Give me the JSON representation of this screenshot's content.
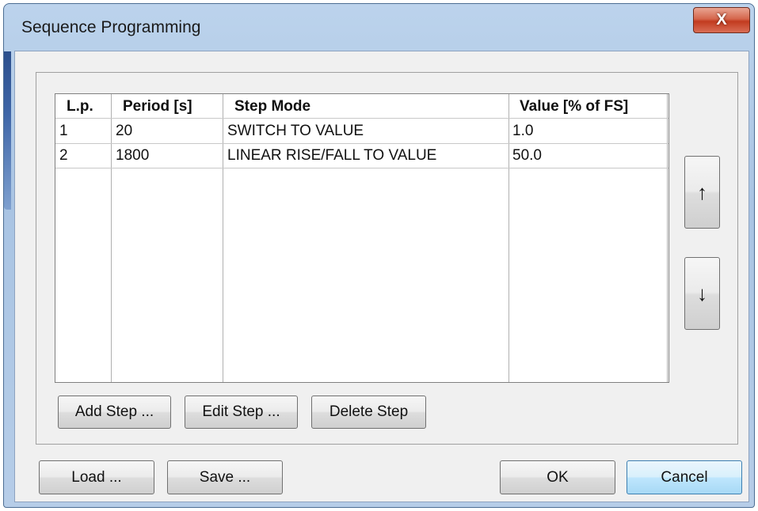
{
  "window": {
    "title": "Sequence Programming",
    "close_glyph": "X"
  },
  "table": {
    "headers": [
      "L.p.",
      "Period [s]",
      "Step Mode",
      "Value [% of FS]"
    ],
    "rows": [
      [
        "1",
        "20",
        "SWITCH TO VALUE",
        "1.0"
      ],
      [
        "2",
        "1800",
        "LINEAR RISE/FALL TO VALUE",
        "50.0"
      ]
    ]
  },
  "buttons": {
    "add_step": "Add Step ...",
    "edit_step": "Edit Step ...",
    "delete_step": "Delete Step",
    "move_up": "↑",
    "move_down": "↓",
    "load": "Load ...",
    "save": "Save ...",
    "ok": "OK",
    "cancel": "Cancel"
  },
  "icons": {
    "move_up": "arrow-up-icon",
    "move_down": "arrow-down-icon",
    "close": "close-icon"
  },
  "colors": {
    "title_bar": "#a9c4e3",
    "close_button": "#c23b1f",
    "default_button_border": "#3c7fb1"
  }
}
